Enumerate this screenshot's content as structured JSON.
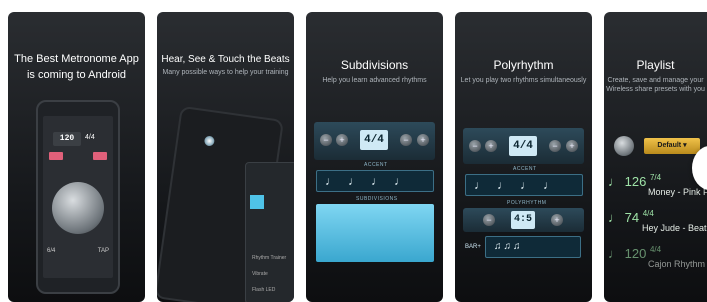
{
  "cards": [
    {
      "title_line1": "The Best Metronome App",
      "title_line2": "is coming to Android"
    },
    {
      "title": "Hear, See & Touch the Beats",
      "subtitle": "Many possible ways to help your training"
    },
    {
      "title": "Subdivisions",
      "subtitle": "Help you learn advanced rhythms",
      "time_sig": "4/4",
      "accent_label": "ACCENT",
      "subdiv_label": "SUBDIVISIONS"
    },
    {
      "title": "Polyrhythm",
      "subtitle": "Let you play two rhythms simultaneously",
      "time_sig": "4/4",
      "accent_label": "ACCENT",
      "poly_label": "POLYRHYTHM",
      "poly_value": "4:5",
      "bar_label": "BAR+"
    },
    {
      "title": "Playlist",
      "subtitle_line1": "Create, save and manage your",
      "subtitle_line2": "Wireless share presets with you",
      "dropdown": "Default",
      "items": [
        {
          "bpm": "126",
          "sig": "7/4",
          "name": "Money - Pink F"
        },
        {
          "bpm": "74",
          "sig": "4/4",
          "name": "Hey Jude - Beatle"
        },
        {
          "bpm": "120",
          "sig": "4/4",
          "name": "Cajon Rhythm"
        }
      ]
    }
  ],
  "phone": {
    "bpm": "120",
    "sig": "4/4",
    "btn_left": "6/4",
    "btn_right": "TAP"
  },
  "card2_menu": [
    "Rhythm Trainer",
    "Vibrate",
    "Flash LED"
  ],
  "colors": {
    "accent": "#4fc3e8",
    "lcd": "#cfe9f5",
    "playlist_green": "#9fe3a8"
  }
}
